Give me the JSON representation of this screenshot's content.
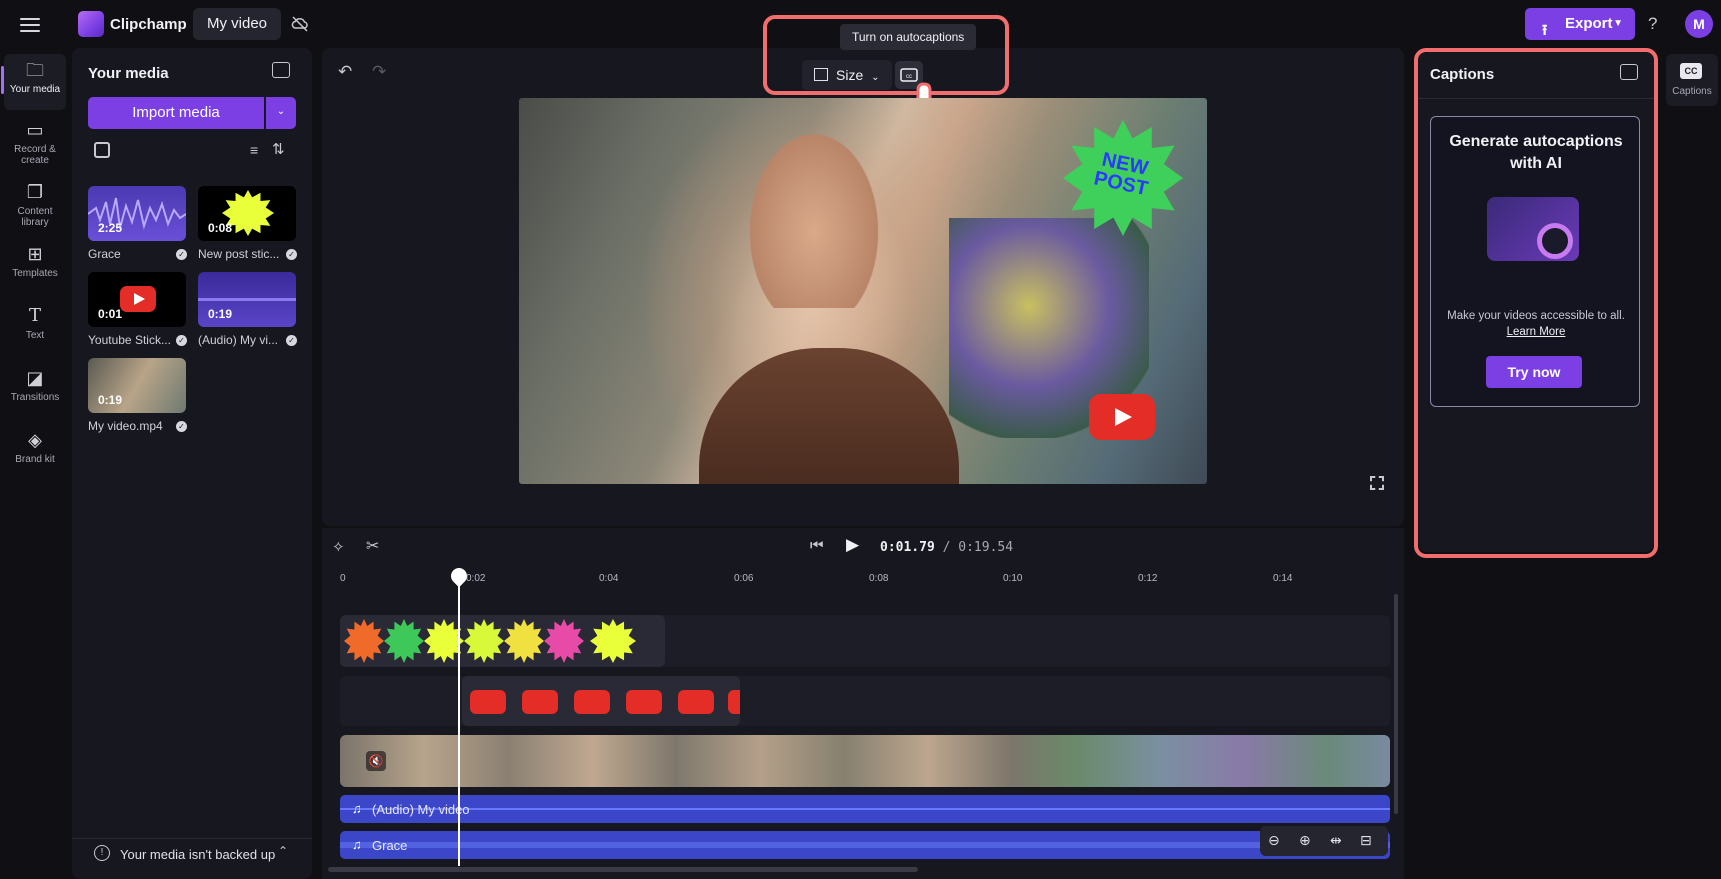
{
  "app": {
    "name": "Clipchamp",
    "project_tab": "My video",
    "export_label": "Export",
    "help": "?",
    "avatar_initial": "M"
  },
  "rail": [
    {
      "label": "Your media"
    },
    {
      "label": "Record & create"
    },
    {
      "label": "Content library"
    },
    {
      "label": "Templates"
    },
    {
      "label": "Text"
    },
    {
      "label": "Transitions"
    },
    {
      "label": "Brand kit"
    }
  ],
  "media_panel": {
    "title": "Your media",
    "import_label": "Import media",
    "items": [
      {
        "name": "Grace",
        "duration": "2:25"
      },
      {
        "name": "New post stic...",
        "duration": "0:08"
      },
      {
        "name": "Youtube Stick...",
        "duration": "0:01"
      },
      {
        "name": "(Audio) My vi...",
        "duration": "0:19"
      },
      {
        "name": "My video.mp4",
        "duration": "0:19"
      }
    ],
    "backup_text": "Your media isn't backed up"
  },
  "stage": {
    "size_label": "Size",
    "tooltip": "Turn on autocaptions",
    "sticker_text": [
      "NEW",
      "POST"
    ]
  },
  "timeline": {
    "current_time": "0:01.79",
    "total_time": "/ 0:19.54",
    "ticks": [
      "0",
      "0:02",
      "0:04",
      "0:06",
      "0:08",
      "0:10",
      "0:12",
      "0:14"
    ],
    "audio_tracks": [
      {
        "label": "(Audio) My video"
      },
      {
        "label": "Grace"
      }
    ]
  },
  "captions_panel": {
    "title": "Captions",
    "card_title": "Generate autocaptions with AI",
    "description": "Make your videos accessible to all.",
    "learn_more": "Learn More",
    "try_now": "Try now",
    "rail_label": "Captions",
    "rail_badge": "CC"
  },
  "colors": {
    "accent": "#7b3fe4",
    "highlight": "#f26d6d",
    "background": "#0f0f14",
    "panel": "#17171f"
  }
}
